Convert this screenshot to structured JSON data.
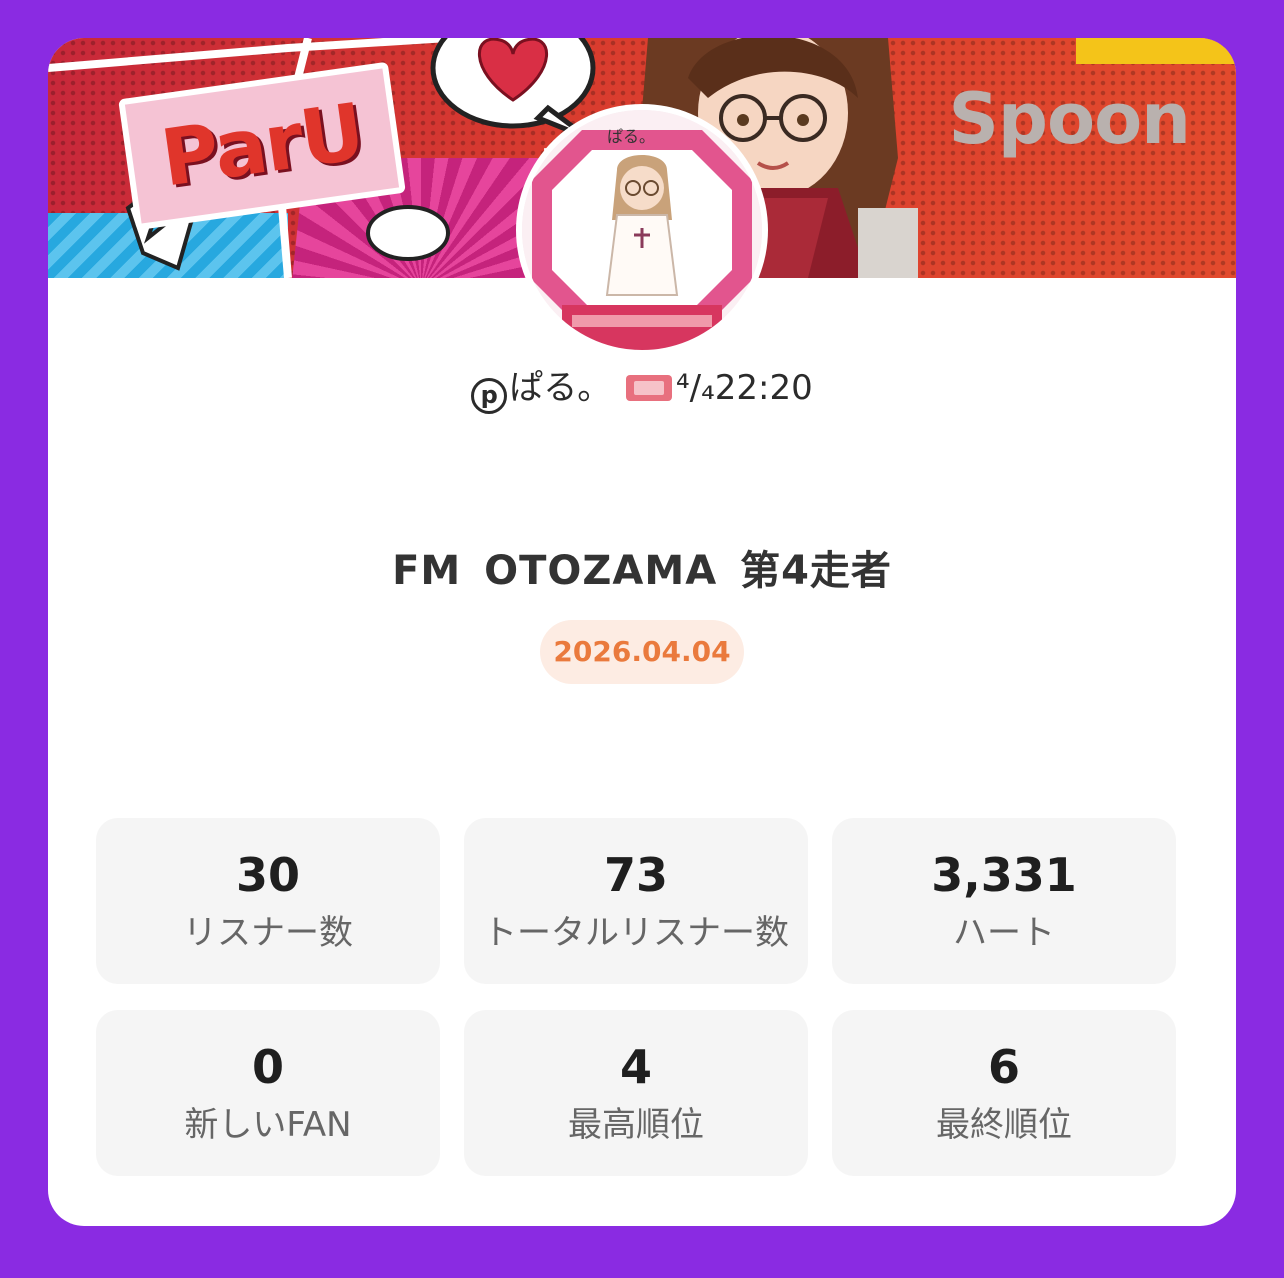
{
  "banner": {
    "left_logo_text": "ParU",
    "right_logo_text": "Spoon"
  },
  "avatar": {
    "caption": "ぱる。"
  },
  "dj": {
    "name_prefix": "p",
    "name": "ぱる。",
    "ticket_icon": "admit-one-ticket-icon",
    "schedule": "⁴/₄22:20"
  },
  "broadcast": {
    "title": "FM OTOZAMA 第4走者",
    "date": "2026.04.04"
  },
  "stats": [
    {
      "value": "30",
      "label": "リスナー数"
    },
    {
      "value": "73",
      "label": "トータルリスナー数"
    },
    {
      "value": "3,331",
      "label": "ハート"
    },
    {
      "value": "0",
      "label": "新しいFAN"
    },
    {
      "value": "4",
      "label": "最高順位"
    },
    {
      "value": "6",
      "label": "最終順位"
    }
  ],
  "colors": {
    "background": "#8A2BE2",
    "date_text": "#EA7A3D",
    "date_pill": "#FDECE3",
    "stat_card": "#F5F5F5"
  }
}
